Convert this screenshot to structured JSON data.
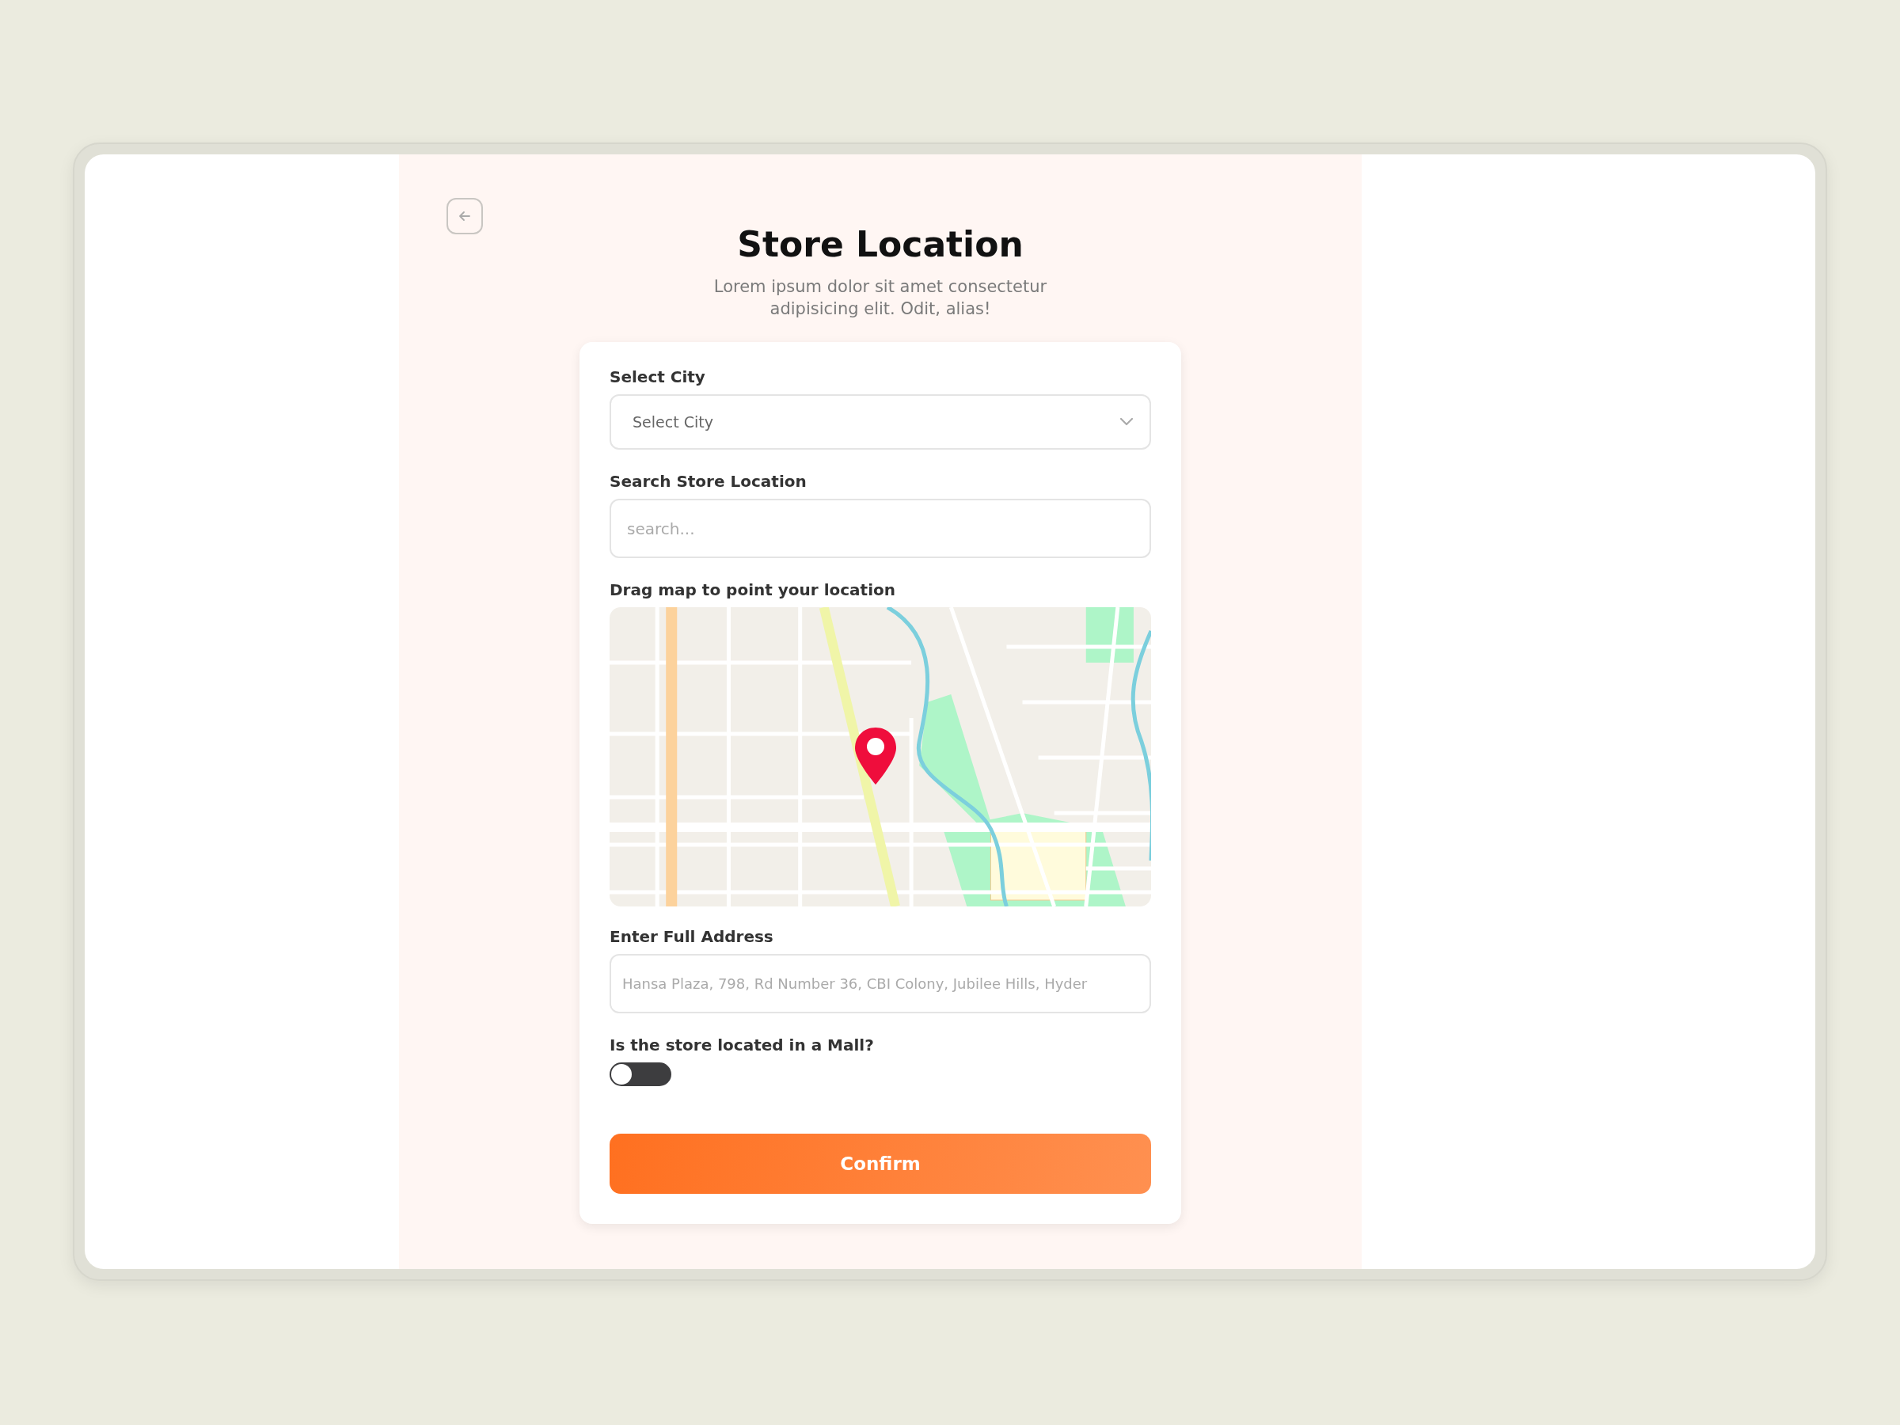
{
  "header": {
    "title": "Store Location",
    "subtitle": "Lorem ipsum dolor sit amet consectetur adipisicing elit. Odit, alias!"
  },
  "form": {
    "city": {
      "label": "Select City",
      "placeholder": "Select City"
    },
    "search": {
      "label": "Search Store Location",
      "placeholder": "search..."
    },
    "map": {
      "label": "Drag map to point your location"
    },
    "address": {
      "label": "Enter Full Address",
      "placeholder": "Hansa Plaza, 798, Rd Number 36, CBI Colony, Jubilee Hills, Hyder"
    },
    "mall": {
      "label": "Is the store located in a Mall?",
      "checked": false
    },
    "confirm": {
      "label": "Confirm"
    }
  }
}
